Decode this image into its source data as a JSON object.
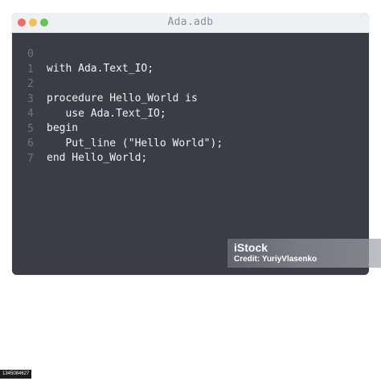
{
  "window": {
    "title": "Ada.adb",
    "traffic_lights": {
      "close_color": "#f26b5e",
      "minimize_color": "#f6bd4f",
      "zoom_color": "#62c655"
    },
    "background_color": "#3a3d45",
    "title_bar_color": "#eef0f3"
  },
  "code": {
    "lines": [
      {
        "number": "0",
        "text": "with Ada.Text_IO;"
      },
      {
        "number": "1",
        "text": ""
      },
      {
        "number": "2",
        "text": "procedure Hello_World is"
      },
      {
        "number": "3",
        "text": "   use Ada.Text_IO;"
      },
      {
        "number": "4",
        "text": "begin"
      },
      {
        "number": "5",
        "text": "   Put_line (\"Hello World\");"
      },
      {
        "number": "6",
        "text": "end Hello_World;"
      },
      {
        "number": "7",
        "text": ""
      }
    ]
  },
  "watermark": {
    "logo": "iStock",
    "credit": "Credit: YuriyVlasenko"
  },
  "stock_id": "1345084627"
}
